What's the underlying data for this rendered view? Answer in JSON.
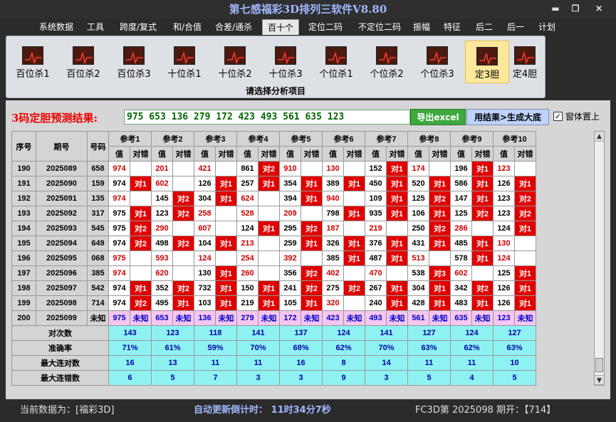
{
  "window": {
    "title": "第七感福彩3D排列三软件V8.80",
    "minimize": "▬",
    "restore": "❐",
    "close": "✕"
  },
  "menu": [
    "系统数据",
    "工具",
    "跨度/复式",
    "和/合值",
    "合差/通杀",
    "百十个",
    "定位二码",
    "不定位二码",
    "振幅",
    "特征",
    "后二",
    "后一",
    "计划"
  ],
  "menu_active": "百十个",
  "ribbon": {
    "buttons": [
      "百位杀1",
      "百位杀2",
      "百位杀3",
      "十位杀1",
      "十位杀2",
      "十位杀3",
      "个位杀1",
      "个位杀2",
      "个位杀3",
      "定3胆",
      "定4胆"
    ],
    "selected": "定3胆",
    "footer": "请选择分析项目",
    "icon": "chart-icon"
  },
  "prediction": {
    "label": "3码定胆预测结果:",
    "value": "975 653 136 279 172 423 493 561 635 123",
    "export_label": "导出excel",
    "generate_label": "用结果>生成大底",
    "topmost_label": "窗体置上",
    "topmost_checked": "✓"
  },
  "table": {
    "head_seq": "序号",
    "head_period": "期号",
    "head_number": "号码",
    "ref_headers": [
      "参考1",
      "参考2",
      "参考3",
      "参考4",
      "参考5",
      "参考6",
      "参考7",
      "参考8",
      "参考9",
      "参考10"
    ],
    "sub_val": "值",
    "sub_check": "对错",
    "rows": [
      {
        "seq": "190",
        "period": "2025089",
        "num": "658",
        "cells": [
          [
            "974",
            "",
            "r"
          ],
          [
            "201",
            "",
            "r"
          ],
          [
            "421",
            "",
            "r"
          ],
          [
            "861",
            "对2",
            "k"
          ],
          [
            "910",
            "",
            "r"
          ],
          [
            "130",
            "",
            "r"
          ],
          [
            "152",
            "对1",
            "k"
          ],
          [
            "174",
            "",
            "r"
          ],
          [
            "196",
            "对1",
            "k"
          ],
          [
            "123",
            "",
            "r"
          ]
        ]
      },
      {
        "seq": "191",
        "period": "2025090",
        "num": "159",
        "cells": [
          [
            "974",
            "对1",
            "k"
          ],
          [
            "602",
            "",
            "r"
          ],
          [
            "126",
            "对1",
            "k"
          ],
          [
            "257",
            "对1",
            "k"
          ],
          [
            "354",
            "对1",
            "k"
          ],
          [
            "389",
            "对1",
            "k"
          ],
          [
            "450",
            "对1",
            "k"
          ],
          [
            "520",
            "对1",
            "k"
          ],
          [
            "586",
            "对1",
            "k"
          ],
          [
            "126",
            "对1",
            "k"
          ]
        ]
      },
      {
        "seq": "192",
        "period": "2025091",
        "num": "135",
        "cells": [
          [
            "974",
            "",
            "r"
          ],
          [
            "145",
            "对2",
            "k"
          ],
          [
            "304",
            "对1",
            "k"
          ],
          [
            "624",
            "",
            "r"
          ],
          [
            "394",
            "对1",
            "k"
          ],
          [
            "940",
            "",
            "r"
          ],
          [
            "109",
            "对1",
            "k"
          ],
          [
            "125",
            "对2",
            "k"
          ],
          [
            "147",
            "对1",
            "k"
          ],
          [
            "123",
            "对2",
            "k"
          ]
        ]
      },
      {
        "seq": "193",
        "period": "2025092",
        "num": "317",
        "cells": [
          [
            "975",
            "对1",
            "k"
          ],
          [
            "123",
            "对2",
            "k"
          ],
          [
            "258",
            "",
            "r"
          ],
          [
            "528",
            "",
            "r"
          ],
          [
            "209",
            "",
            "r"
          ],
          [
            "798",
            "对1",
            "k"
          ],
          [
            "935",
            "对1",
            "k"
          ],
          [
            "106",
            "对1",
            "k"
          ],
          [
            "125",
            "对2",
            "k"
          ],
          [
            "123",
            "对2",
            "k"
          ]
        ]
      },
      {
        "seq": "194",
        "period": "2025093",
        "num": "545",
        "cells": [
          [
            "975",
            "对2",
            "k"
          ],
          [
            "290",
            "",
            "r"
          ],
          [
            "607",
            "",
            "r"
          ],
          [
            "124",
            "对1",
            "k"
          ],
          [
            "295",
            "对2",
            "k"
          ],
          [
            "187",
            "",
            "r"
          ],
          [
            "219",
            "",
            "r"
          ],
          [
            "250",
            "对2",
            "k"
          ],
          [
            "286",
            "",
            "r"
          ],
          [
            "124",
            "对1",
            "k"
          ]
        ]
      },
      {
        "seq": "195",
        "period": "2025094",
        "num": "649",
        "cells": [
          [
            "974",
            "对2",
            "k"
          ],
          [
            "498",
            "对2",
            "k"
          ],
          [
            "104",
            "对1",
            "k"
          ],
          [
            "213",
            "",
            "r"
          ],
          [
            "259",
            "对1",
            "k"
          ],
          [
            "326",
            "对1",
            "k"
          ],
          [
            "376",
            "对1",
            "k"
          ],
          [
            "431",
            "对1",
            "k"
          ],
          [
            "485",
            "对1",
            "k"
          ],
          [
            "130",
            "",
            "r"
          ]
        ]
      },
      {
        "seq": "196",
        "period": "2025095",
        "num": "068",
        "cells": [
          [
            "975",
            "",
            "r"
          ],
          [
            "593",
            "",
            "r"
          ],
          [
            "124",
            "",
            "r"
          ],
          [
            "254",
            "",
            "r"
          ],
          [
            "392",
            "",
            "r"
          ],
          [
            "385",
            "对1",
            "k"
          ],
          [
            "487",
            "对1",
            "k"
          ],
          [
            "513",
            "",
            "r"
          ],
          [
            "578",
            "对1",
            "k"
          ],
          [
            "124",
            "",
            "r"
          ]
        ]
      },
      {
        "seq": "197",
        "period": "2025096",
        "num": "385",
        "cells": [
          [
            "974",
            "",
            "r"
          ],
          [
            "620",
            "",
            "r"
          ],
          [
            "130",
            "对1",
            "k"
          ],
          [
            "260",
            "",
            "r"
          ],
          [
            "356",
            "对2",
            "k"
          ],
          [
            "402",
            "",
            "r"
          ],
          [
            "470",
            "",
            "r"
          ],
          [
            "538",
            "对3",
            "k"
          ],
          [
            "602",
            "",
            "r"
          ],
          [
            "125",
            "对1",
            "k"
          ]
        ]
      },
      {
        "seq": "198",
        "period": "2025097",
        "num": "542",
        "cells": [
          [
            "974",
            "对1",
            "k"
          ],
          [
            "352",
            "对2",
            "k"
          ],
          [
            "732",
            "对1",
            "k"
          ],
          [
            "150",
            "对1",
            "k"
          ],
          [
            "241",
            "对2",
            "k"
          ],
          [
            "275",
            "对2",
            "k"
          ],
          [
            "267",
            "对1",
            "k"
          ],
          [
            "304",
            "对1",
            "k"
          ],
          [
            "342",
            "对2",
            "k"
          ],
          [
            "126",
            "对1",
            "k"
          ]
        ]
      },
      {
        "seq": "199",
        "period": "2025098",
        "num": "714",
        "cells": [
          [
            "974",
            "对2",
            "k"
          ],
          [
            "495",
            "对1",
            "k"
          ],
          [
            "103",
            "对1",
            "k"
          ],
          [
            "219",
            "对1",
            "k"
          ],
          [
            "105",
            "对1",
            "k"
          ],
          [
            "320",
            "",
            "r"
          ],
          [
            "240",
            "对1",
            "k"
          ],
          [
            "428",
            "对1",
            "k"
          ],
          [
            "483",
            "对1",
            "k"
          ],
          [
            "126",
            "对1",
            "k"
          ]
        ]
      }
    ],
    "forecast": {
      "seq": "200",
      "period": "2025099",
      "num": "未知",
      "cells": [
        [
          "975",
          "未知"
        ],
        [
          "653",
          "未知"
        ],
        [
          "136",
          "未知"
        ],
        [
          "279",
          "未知"
        ],
        [
          "172",
          "未知"
        ],
        [
          "423",
          "未知"
        ],
        [
          "493",
          "未知"
        ],
        [
          "561",
          "未知"
        ],
        [
          "635",
          "未知"
        ],
        [
          "123",
          "未知"
        ]
      ]
    },
    "stats": [
      {
        "label": "对次数",
        "values": [
          "143",
          "123",
          "118",
          "141",
          "137",
          "124",
          "141",
          "127",
          "124",
          "127"
        ]
      },
      {
        "label": "准确率",
        "values": [
          "71%",
          "61%",
          "59%",
          "70%",
          "68%",
          "62%",
          "70%",
          "63%",
          "62%",
          "63%"
        ]
      },
      {
        "label": "最大连对数",
        "values": [
          "16",
          "13",
          "11",
          "11",
          "16",
          "8",
          "14",
          "11",
          "11",
          "10"
        ]
      },
      {
        "label": "最大连错数",
        "values": [
          "6",
          "5",
          "7",
          "3",
          "3",
          "9",
          "3",
          "5",
          "4",
          "5"
        ]
      }
    ]
  },
  "status": {
    "left": "当前数据为：[福彩3D]",
    "mid": "自动更新倒计时：  11时34分7秒",
    "right": "FC3D第 2025098 期开：【714】"
  }
}
